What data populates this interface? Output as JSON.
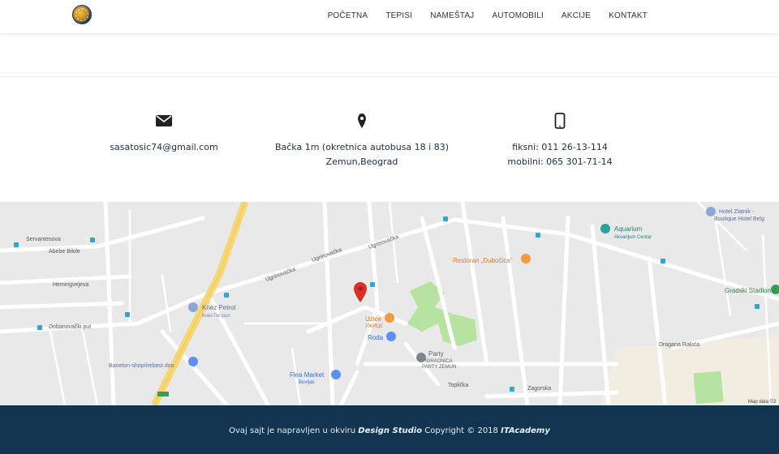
{
  "nav": {
    "items": [
      {
        "label": "POČETNA"
      },
      {
        "label": "TEPISI"
      },
      {
        "label": "NAMEŠTAJ"
      },
      {
        "label": "AUTOMOBILI"
      },
      {
        "label": "AKCIJE"
      },
      {
        "label": "KONTAKT"
      }
    ]
  },
  "contact": {
    "email": "sasatosic74@gmail.com",
    "address_line1": "Bačka 1m (okretnica autobusa 18 i 83)",
    "address_line2": "Zemun,Beograd",
    "phone_fixed": "fiksni: 011 26-13-114",
    "phone_mobile": "mobilni: 065 301-71-14"
  },
  "map": {
    "labels": {
      "servantesova": "Servantesova",
      "abebe": "Abebe Bikile",
      "hemingvejeva": "Hemingvejeva",
      "ugrinovacka1": "Ugrinovačka",
      "ugrinovacka2": "Ugrinovačka",
      "ugrinovacka3": "Ugrinovačka",
      "dobanovacki": "Dobanovački put",
      "knez_petrol": "Knez Petrol",
      "knez_petrol_cyr": "Кнез Петрол",
      "baneton": "Baneton-shop/Irebest doo",
      "restoran": "Restoran „Dubočica\"",
      "uzice": "Uzice",
      "uzice_cyr": "УЖИЦЕ",
      "roda": "Roda",
      "party": "Party",
      "party_sub1": "IGRAONICA",
      "party_sub2": "PARTY ZEMUN",
      "flea": "Flea Market",
      "flea_cyr": "Buvljak",
      "aquarium": "Aquarium",
      "aquarium_sub": "Akvarijum Centar",
      "hotel1": "Hotel Zlatnik -",
      "hotel2": "Boutique Hotel Belg",
      "gradski": "Gradski Stadion Z",
      "dragana": "Dragana Rakića",
      "toplicka": "Toplička",
      "zagorska": "Zagorska",
      "map_data": "Map data ©2"
    }
  },
  "footer": {
    "prefix": "Ovaj sajt je napravljen u okviru ",
    "studio": "Design Studio",
    "copyright": " Copyright © 2018 ",
    "academy": "ITAcademy"
  },
  "colors": {
    "footer_bg": "#11354f",
    "text_dark": "#223046",
    "map_bg": "#e9e9e9",
    "pin_red": "#d93025",
    "park_green": "#b7e3a1"
  }
}
